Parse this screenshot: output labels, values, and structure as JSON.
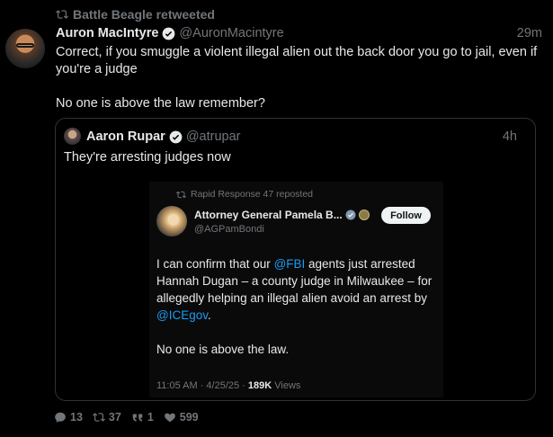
{
  "retweet": {
    "label": "Battle Beagle retweeted"
  },
  "tweet": {
    "author_name": "Auron MacIntyre",
    "author_handle": "@AuronMacintyre",
    "time": "29m",
    "paragraphs": [
      "Correct, if you smuggle a violent illegal alien out the back door you go to jail, even if you're a judge",
      "No one is above the law remember?"
    ]
  },
  "quote": {
    "author_name": "Aaron Rupar",
    "author_handle": "@atrupar",
    "time": "4h",
    "text": "They're arresting judges now",
    "embed": {
      "repost_label": "Rapid Response 47 reposted",
      "author_name": "Attorney General Pamela B...",
      "author_handle": "@AGPamBondi",
      "follow_label": "Follow",
      "body_p1_a": "I can confirm that our ",
      "mention_1": "@FBI",
      "body_p1_b": " agents just arrested Hannah Dugan – a county judge in Milwaukee – for allegedly helping an illegal alien avoid an arrest by ",
      "mention_2": "@ICEgov",
      "body_p1_c": ".",
      "body_p2": "No one is above the law.",
      "meta_time": "11:05 AM · 4/25/25 · ",
      "meta_views_count": "189K",
      "meta_views_label": " Views"
    }
  },
  "stats": {
    "replies": "13",
    "retweets": "37",
    "quotes": "1",
    "likes": "599"
  },
  "colors": {
    "background": "#000000",
    "text": "#e7e9ea",
    "muted": "#71767b",
    "accent": "#1d9bf0",
    "border": "#2f3336"
  },
  "icons": {
    "retweet": "retweet-icon",
    "verified": "verified-badge-icon",
    "reply": "reply-icon",
    "quote": "quote-icon",
    "like": "heart-icon"
  }
}
